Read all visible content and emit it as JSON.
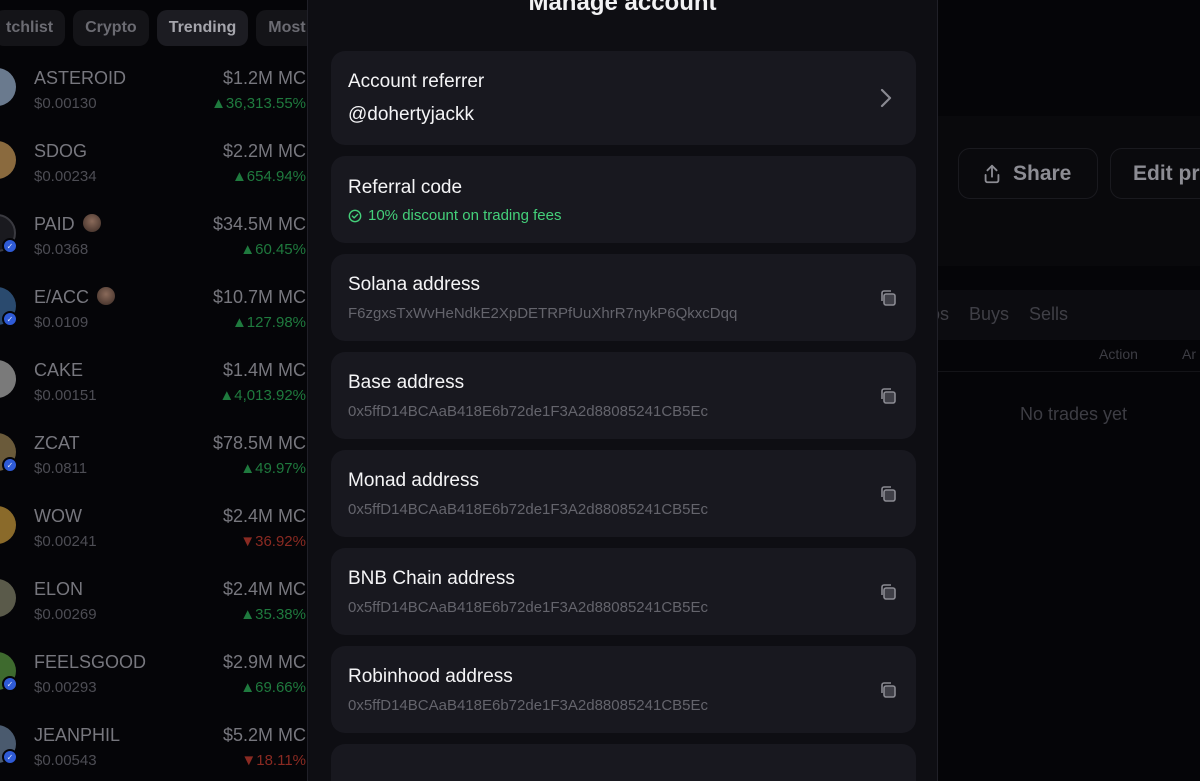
{
  "tabs": [
    "tchlist",
    "Crypto",
    "Trending",
    "Most h"
  ],
  "coins": [
    {
      "name": "ASTEROID",
      "price": "$0.00130",
      "mc": "$1.2M MC",
      "change": "▲36,313.55%",
      "dir": "up",
      "avatar_color": "#6a7a8e"
    },
    {
      "name": "SDOG",
      "price": "$0.00234",
      "mc": "$2.2M MC",
      "change": "▲654.94%",
      "dir": "up",
      "avatar_color": "#8a6a3e"
    },
    {
      "name": "PAID",
      "price": "$0.0368",
      "mc": "$34.5M MC",
      "change": "▲60.45%",
      "dir": "up",
      "avatar_color": "#1a1a1f"
    },
    {
      "name": "E/ACC",
      "price": "$0.0109",
      "mc": "$10.7M MC",
      "change": "▲127.98%",
      "dir": "up",
      "avatar_color": "#2a4a6e"
    },
    {
      "name": "CAKE",
      "price": "$0.00151",
      "mc": "$1.4M MC",
      "change": "▲4,013.92%",
      "dir": "up",
      "avatar_color": "#7a7a7a"
    },
    {
      "name": "ZCAT",
      "price": "$0.0811",
      "mc": "$78.5M MC",
      "change": "▲49.97%",
      "dir": "up",
      "avatar_color": "#6a5a3a"
    },
    {
      "name": "WOW",
      "price": "$0.00241",
      "mc": "$2.4M MC",
      "change": "▼36.92%",
      "dir": "down",
      "avatar_color": "#8a6a2a"
    },
    {
      "name": "ELON",
      "price": "$0.00269",
      "mc": "$2.4M MC",
      "change": "▲35.38%",
      "dir": "up",
      "avatar_color": "#5a5a4a"
    },
    {
      "name": "FEELSGOOD",
      "price": "$0.00293",
      "mc": "$2.9M MC",
      "change": "▲69.66%",
      "dir": "up",
      "avatar_color": "#3e6a2e"
    },
    {
      "name": "JEANPHIL",
      "price": "$0.00543",
      "mc": "$5.2M MC",
      "change": "▼18.11%",
      "dir": "down",
      "avatar_color": "#4a5a6e"
    }
  ],
  "right": {
    "share_label": "Share",
    "edit_label": "Edit pr",
    "trade_tabs": [
      "os",
      "Buys",
      "Sells"
    ],
    "headers": [
      "Action",
      "Ar"
    ],
    "empty": "No trades yet"
  },
  "modal": {
    "title": "Manage account",
    "referrer_title": "Account referrer",
    "referrer_value": "@dohertyjackk",
    "referral_title": "Referral code",
    "referral_note": "10% discount on trading fees",
    "addresses": [
      {
        "title": "Solana address",
        "value": "F6zgxsTxWvHeNdkE2XpDETRPfUuXhrR7nykP6QkxcDqq"
      },
      {
        "title": "Base address",
        "value": "0x5ffD14BCAaB418E6b72de1F3A2d88085241CB5Ec"
      },
      {
        "title": "Monad address",
        "value": "0x5ffD14BCAaB418E6b72de1F3A2d88085241CB5Ec"
      },
      {
        "title": "BNB Chain address",
        "value": "0x5ffD14BCAaB418E6b72de1F3A2d88085241CB5Ec"
      },
      {
        "title": "Robinhood address",
        "value": "0x5ffD14BCAaB418E6b72de1F3A2d88085241CB5Ec"
      }
    ]
  },
  "colors": {
    "accent_green": "#44d07a",
    "down_red": "#8a2a22",
    "card_bg": "#18181f"
  }
}
